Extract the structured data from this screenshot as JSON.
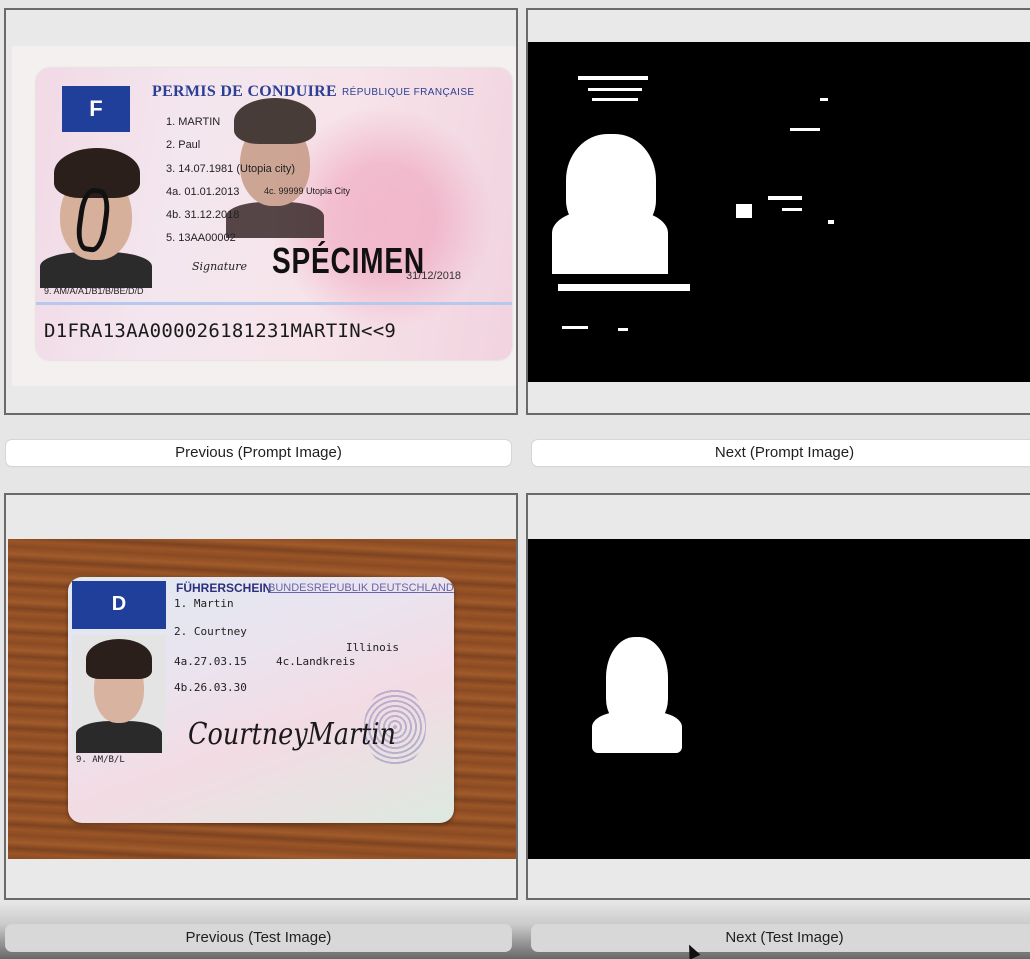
{
  "buttons": {
    "prev_prompt": "Previous (Prompt Image)",
    "next_prompt": "Next (Prompt Image)",
    "prev_test": "Previous (Test Image)",
    "next_test": "Next (Test Image)"
  },
  "prompt_image": {
    "country_letter": "F",
    "title": "PERMIS DE CONDUIRE",
    "subtitle": "RÉPUBLIQUE FRANÇAISE",
    "lines": [
      "1.  MARTIN",
      "2.  Paul",
      "3.  14.07.1981 (Utopia city)",
      "4a. 01.01.2013",
      "4c. 99999 Utopia City",
      "4b. 31.12.2018",
      "5.  13AA00002"
    ],
    "signature_label": "Signature",
    "specimen": "SPÉCIMEN",
    "date_right": "31/12/2018",
    "categories": "9.  AM/A/A1/B1/B/BE/D/D",
    "mrz": "D1FRA13AA000026181231MARTIN<<9"
  },
  "test_image": {
    "country_letter": "D",
    "title": "FÜHRERSCHEIN",
    "subtitle": "BUNDESREPUBLIK DEUTSCHLAND",
    "lines": [
      "1. Martin",
      "2. Courtney",
      "Illinois",
      "4a.27.03.15",
      "4c.Landkreis",
      "4b.26.03.30",
      "9. AM/B/L"
    ],
    "signature": "CourtneyMartin"
  },
  "colors": {
    "mask_background": "#000000",
    "mask_foreground": "#ffffff",
    "eu_blue": "#1f3f9a"
  }
}
